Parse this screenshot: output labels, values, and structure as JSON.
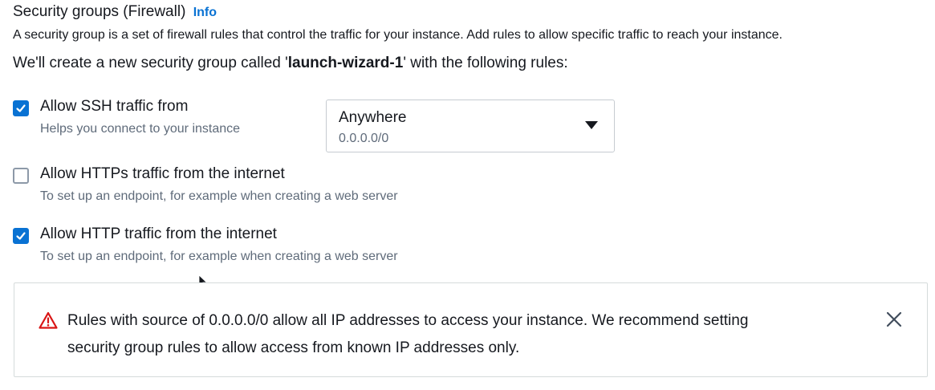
{
  "section": {
    "title": "Security groups (Firewall)",
    "info_link": "Info",
    "description": "A security group is a set of firewall rules that control the traffic for your instance. Add rules to allow specific traffic to reach your instance.",
    "create_prefix": "We'll create a new security group called '",
    "group_name": "launch-wizard-1",
    "create_suffix": "' with the following rules:"
  },
  "rules": {
    "ssh": {
      "label": "Allow SSH traffic from",
      "hint": "Helps you connect to your instance",
      "checked": true
    },
    "https": {
      "label": "Allow HTTPs traffic from the internet",
      "hint": "To set up an endpoint, for example when creating a web server",
      "checked": false
    },
    "http": {
      "label": "Allow HTTP traffic from the internet",
      "hint": "To set up an endpoint, for example when creating a web server",
      "checked": true
    }
  },
  "ssh_source": {
    "selected": "Anywhere",
    "sub": "0.0.0.0/0"
  },
  "alert": {
    "line1": "Rules with source of 0.0.0.0/0 allow all IP addresses to access your instance. We recommend setting",
    "line2": "security group rules to allow access from known IP addresses only."
  },
  "icons": {
    "warning": "warning-triangle-icon",
    "close": "close-icon",
    "checkbox": "checkmark-icon",
    "dropdown": "caret-down-icon"
  },
  "colors": {
    "accent": "#0972d3",
    "warning": "#d91515",
    "text": "#16191f",
    "muted": "#5f6b7a"
  }
}
